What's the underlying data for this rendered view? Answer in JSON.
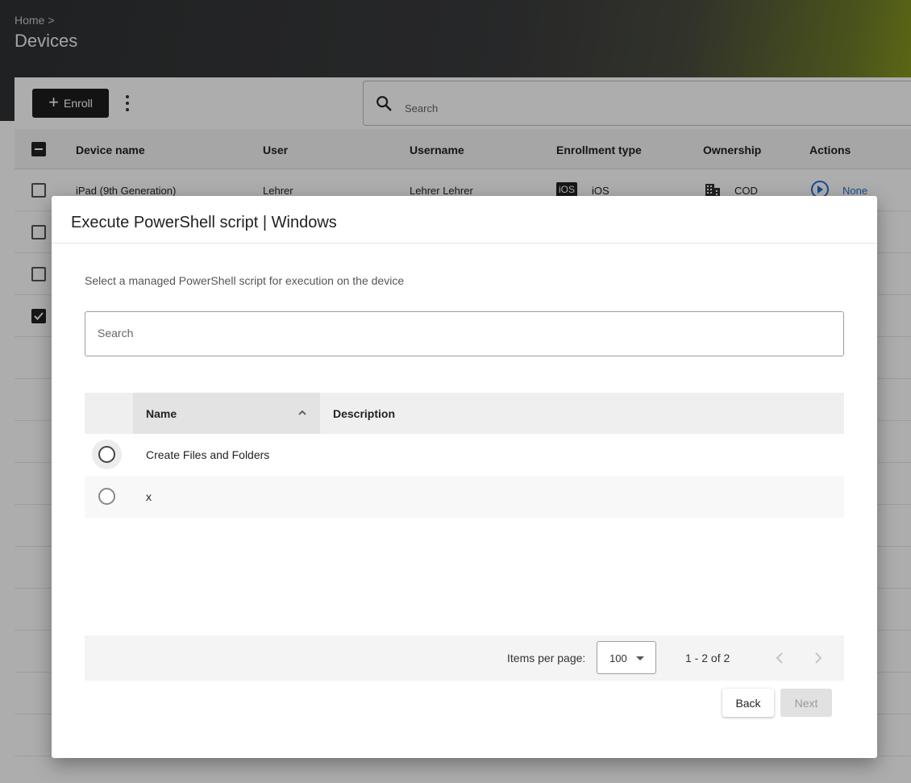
{
  "header": {
    "breadcrumb_home": "Home",
    "breadcrumb_sep": ">",
    "title": "Devices"
  },
  "toolbar": {
    "enroll_label": "Enroll",
    "search_placeholder": "Search"
  },
  "devices_table": {
    "columns": [
      "Device name",
      "User",
      "Username",
      "Enrollment type",
      "Ownership",
      "Actions"
    ],
    "rows": [
      {
        "device_name": "iPad (9th Generation)",
        "user": "Lehrer",
        "username": "Lehrer Lehrer",
        "enrollment_badge": "iOS",
        "enrollment_type": "iOS",
        "ownership": "COD",
        "action_label": "None"
      }
    ]
  },
  "dialog": {
    "title": "Execute PowerShell script | Windows",
    "description": "Select a managed PowerShell script for execution on the device",
    "search_placeholder": "Search",
    "columns": {
      "name": "Name",
      "description": "Description"
    },
    "scripts": [
      {
        "name": "Create Files and Folders",
        "description": ""
      },
      {
        "name": "x",
        "description": ""
      }
    ],
    "pagination": {
      "items_per_page_label": "Items per page:",
      "items_per_page_value": "100",
      "range": "1 - 2 of 2"
    },
    "back_label": "Back",
    "next_label": "Next"
  }
}
